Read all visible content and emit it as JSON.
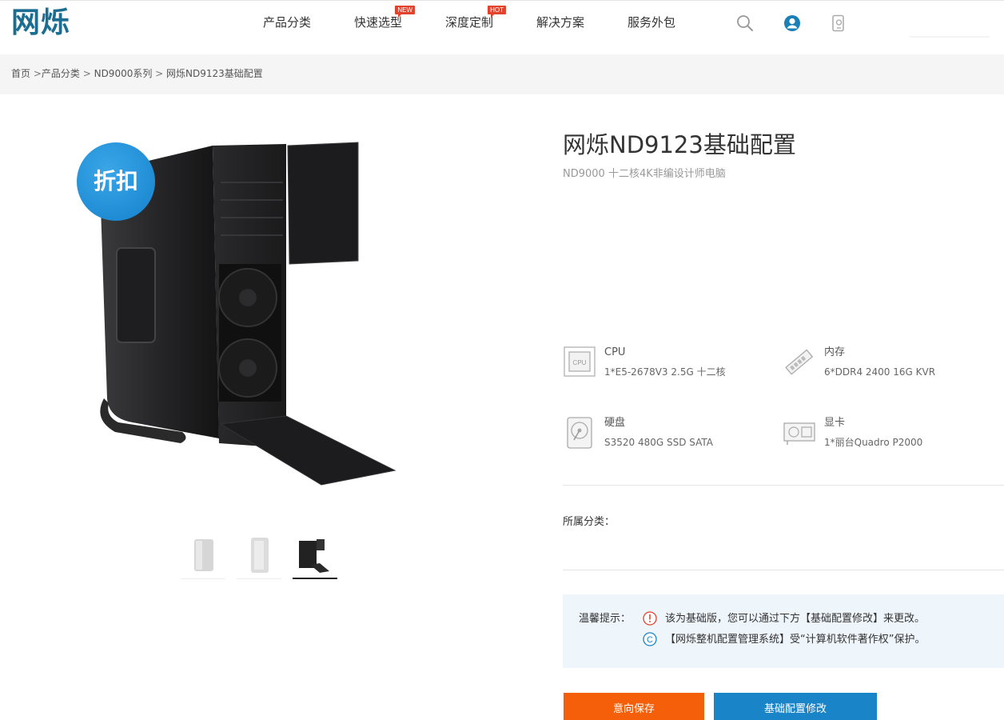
{
  "header": {
    "logo": "网烁",
    "nav": [
      {
        "label": "产品分类",
        "badge": ""
      },
      {
        "label": "快速选型",
        "badge": "NEW"
      },
      {
        "label": "深度定制",
        "badge": "HOT"
      },
      {
        "label": "解决方案",
        "badge": ""
      },
      {
        "label": "服务外包",
        "badge": ""
      }
    ],
    "icons": [
      "search-icon",
      "user-icon",
      "phone-icon"
    ]
  },
  "breadcrumb": {
    "items": [
      "首页",
      "产品分类",
      "ND9000系列",
      "网烁ND9123基础配置"
    ],
    "sep_first": " >",
    "sep": " > "
  },
  "product": {
    "discount_badge": "折扣",
    "title": "网烁ND9123基础配置",
    "subtitle": "ND9000 十二核4K非编设计师电脑",
    "specs": [
      {
        "name": "CPU",
        "value": "1*E5-2678V3 2.5G 十二核",
        "icon": "cpu-icon"
      },
      {
        "name": "内存",
        "value": "6*DDR4 2400 16G KVR",
        "icon": "memory-icon"
      },
      {
        "name": "硬盘",
        "value": "S3520 480G SSD SATA",
        "icon": "disk-icon"
      },
      {
        "name": "显卡",
        "value": "1*丽台Quadro P2000",
        "icon": "gpu-icon"
      }
    ],
    "category_label": "所属分类："
  },
  "tips": {
    "label": "温馨提示：",
    "lines": [
      "该为基础版，您可以通过下方【基础配置修改】来更改。",
      "【网烁整机配置管理系统】受“计算机软件著作权”保护。"
    ]
  },
  "buttons": {
    "save": "意向保存",
    "edit": "基础配置修改"
  },
  "colors": {
    "brand": "#1b6d91",
    "save_button": "#f65f0a",
    "edit_button": "#1a84c8",
    "badge": "#e2432c",
    "discount": "#1581cc"
  }
}
